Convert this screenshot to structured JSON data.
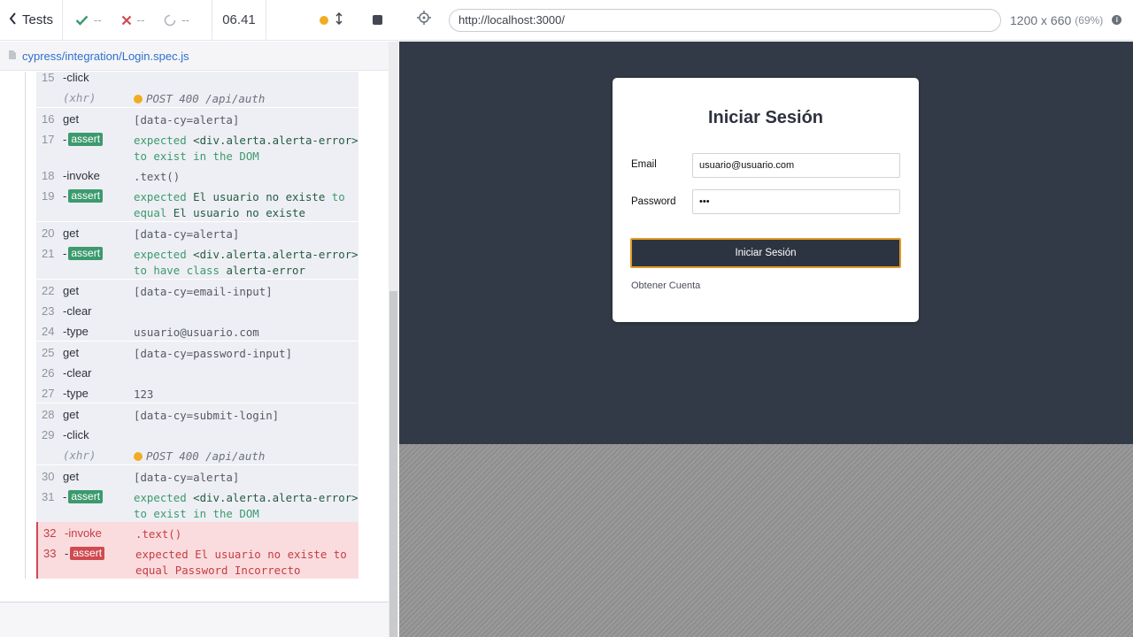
{
  "reporter": {
    "tests_label": "Tests",
    "passed": "--",
    "failed": "--",
    "pending": "--",
    "duration": "06.41",
    "spec_file": "cypress/integration/Login.spec.js"
  },
  "commands": [
    {
      "num": "15",
      "name": "-click",
      "msg": ""
    },
    {
      "num": "",
      "name": "(xhr)",
      "msg": "POST 400 /api/auth",
      "xhr": true
    },
    {
      "num": "16",
      "name": "get",
      "msg": "[data-cy=alerta]"
    },
    {
      "num": "17",
      "name": "-",
      "badge": "assert",
      "msg_parts": [
        "expected ",
        "<div.alerta.alerta-error>",
        " to exist in the DOM"
      ]
    },
    {
      "num": "18",
      "name": "-invoke",
      "msg": ".text()"
    },
    {
      "num": "19",
      "name": "-",
      "badge": "assert",
      "msg_parts": [
        "expected ",
        "El usuario no existe",
        " to equal ",
        "El usuario no existe"
      ]
    },
    {
      "num": "20",
      "name": "get",
      "msg": "[data-cy=alerta]"
    },
    {
      "num": "21",
      "name": "-",
      "badge": "assert",
      "msg_parts": [
        "expected ",
        "<div.alerta.alerta-error>",
        " to have class ",
        "alerta-error"
      ]
    },
    {
      "num": "22",
      "name": "get",
      "msg": "[data-cy=email-input]"
    },
    {
      "num": "23",
      "name": "-clear",
      "msg": ""
    },
    {
      "num": "24",
      "name": "-type",
      "msg": "usuario@usuario.com"
    },
    {
      "num": "25",
      "name": "get",
      "msg": "[data-cy=password-input]"
    },
    {
      "num": "26",
      "name": "-clear",
      "msg": ""
    },
    {
      "num": "27",
      "name": "-type",
      "msg": "123"
    },
    {
      "num": "28",
      "name": "get",
      "msg": "[data-cy=submit-login]"
    },
    {
      "num": "29",
      "name": "-click",
      "msg": ""
    },
    {
      "num": "",
      "name": "(xhr)",
      "msg": "POST 400 /api/auth",
      "xhr": true
    },
    {
      "num": "30",
      "name": "get",
      "msg": "[data-cy=alerta]"
    },
    {
      "num": "31",
      "name": "-",
      "badge": "assert",
      "msg_parts": [
        "expected ",
        "<div.alerta.alerta-error>",
        " to exist in the DOM"
      ]
    },
    {
      "num": "32",
      "name": "-invoke",
      "msg": ".text()",
      "failed": true
    },
    {
      "num": "33",
      "name": "-",
      "badge": "assert",
      "failed": true,
      "msg_parts": [
        "expected ",
        "El usuario no existe",
        " to equal ",
        "Password Incorrecto"
      ]
    }
  ],
  "aut": {
    "url": "http://localhost:3000/",
    "viewport": "1200 x 660",
    "scale": "(69%)"
  },
  "login": {
    "title": "Iniciar Sesión",
    "email_label": "Email",
    "email_value": "usuario@usuario.com",
    "password_label": "Password",
    "password_value": "•••",
    "submit_label": "Iniciar Sesión",
    "account_link": "Obtener Cuenta"
  }
}
